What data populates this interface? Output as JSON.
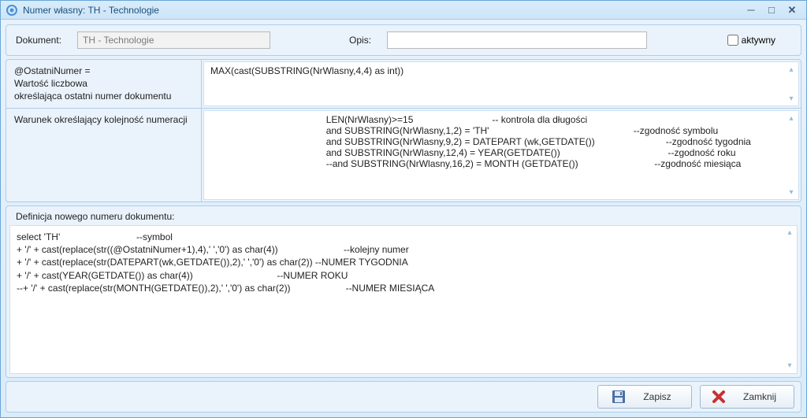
{
  "titlebar": {
    "title": "Numer własny: TH - Technologie"
  },
  "header": {
    "dokument_label": "Dokument:",
    "dokument_value": "TH - Technologie",
    "opis_label": "Opis:",
    "opis_value": "",
    "aktywny_label": "aktywny",
    "aktywny_checked": false
  },
  "section1": {
    "label_line1": "@OstatniNumer =",
    "label_line2": "Wartość liczbowa",
    "label_line3": "określająca ostatni numer dokumentu",
    "content": "MAX(cast(SUBSTRING(NrWlasny,4,4) as int))"
  },
  "section2": {
    "label": "Warunek określający kolejność numeracji",
    "content": "                                            LEN(NrWlasny)>=15                              -- kontrola dla długości\n                                            and SUBSTRING(NrWlasny,1,2) = 'TH'                                                       --zgodność symbolu\n                                            and SUBSTRING(NrWlasny,9,2) = DATEPART (wk,GETDATE())                           --zgodność tygodnia\n                                            and SUBSTRING(NrWlasny,12,4) = YEAR(GETDATE())                                         --zgodność roku\n                                            --and SUBSTRING(NrWlasny,16,2) = MONTH (GETDATE())                             --zgodność miesiąca"
  },
  "section3": {
    "heading": "Definicja nowego numeru dokumentu:",
    "content": "select 'TH'                             --symbol\n+ '/' + cast(replace(str((@OstatniNumer+1),4),' ','0') as char(4))                         --kolejny numer\n+ '/' + cast(replace(str(DATEPART(wk,GETDATE()),2),' ','0') as char(2)) --NUMER TYGODNIA\n+ '/' + cast(YEAR(GETDATE()) as char(4))                                --NUMER ROKU\n--+ '/' + cast(replace(str(MONTH(GETDATE()),2),' ','0') as char(2))                     --NUMER MIESIĄCA"
  },
  "footer": {
    "save_label": "Zapisz",
    "close_label": "Zamknij"
  }
}
